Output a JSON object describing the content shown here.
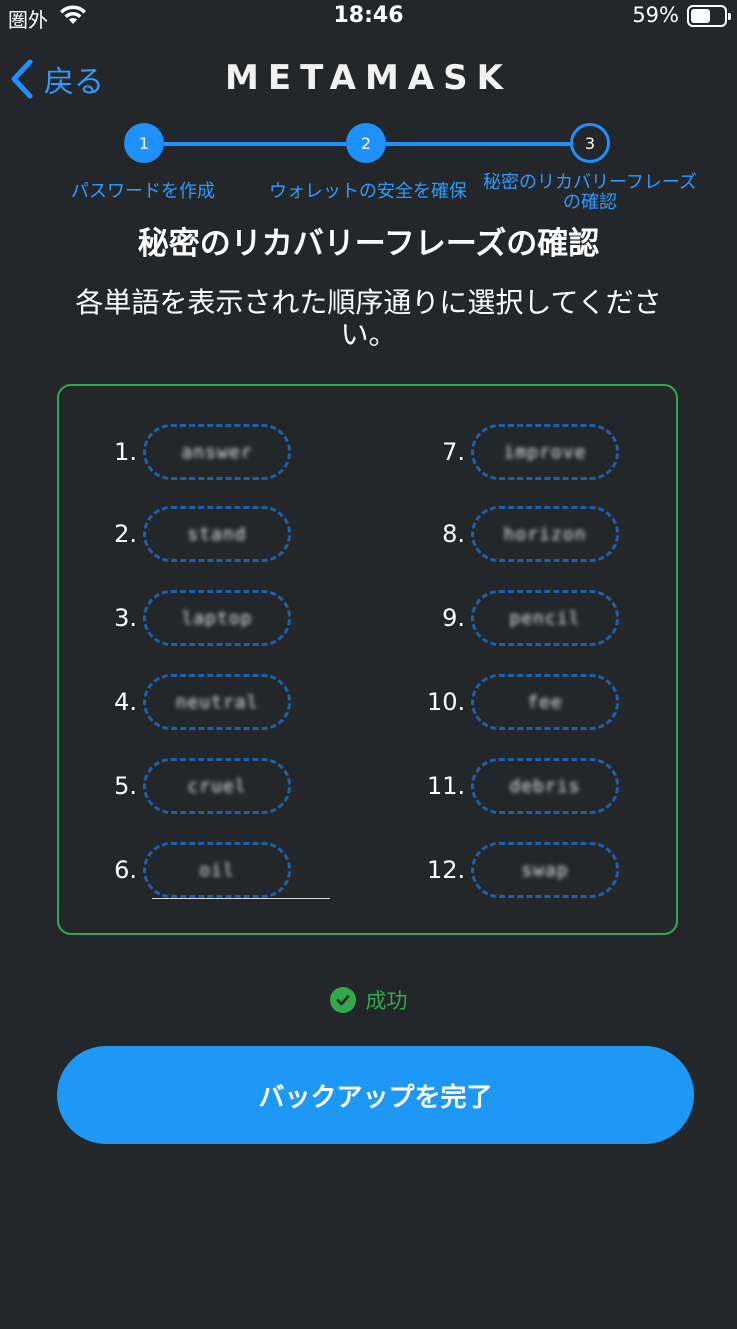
{
  "status_bar": {
    "carrier": "圏外",
    "time": "18:46",
    "battery": "59%",
    "battery_level": 0.59
  },
  "nav": {
    "back_label": "戻る",
    "title": "METAMASK"
  },
  "stepper": {
    "steps": [
      {
        "number": "1",
        "label": "パスワードを作成",
        "state": "done"
      },
      {
        "number": "2",
        "label": "ウォレットの安全を確保",
        "state": "done"
      },
      {
        "number": "3",
        "label": "秘密のリカバリーフレーズの確認",
        "state": "active"
      }
    ]
  },
  "heading": "秘密のリカバリーフレーズの確認",
  "instruction": "各単語を表示された順序通りに選択してください。",
  "words": [
    {
      "number": "1.",
      "word": "answer"
    },
    {
      "number": "2.",
      "word": "stand"
    },
    {
      "number": "3.",
      "word": "laptop"
    },
    {
      "number": "4.",
      "word": "neutral"
    },
    {
      "number": "5.",
      "word": "cruel"
    },
    {
      "number": "6.",
      "word": "oil"
    },
    {
      "number": "7.",
      "word": "improve"
    },
    {
      "number": "8.",
      "word": "horizon"
    },
    {
      "number": "9.",
      "word": "pencil"
    },
    {
      "number": "10.",
      "word": "fee"
    },
    {
      "number": "11.",
      "word": "debris"
    },
    {
      "number": "12.",
      "word": "swap"
    }
  ],
  "success": {
    "label": "成功",
    "color": "#31a84b"
  },
  "complete_button": "バックアップを完了",
  "colors": {
    "accent": "#1e90ff",
    "background": "#24272a",
    "success": "#31a84b"
  }
}
